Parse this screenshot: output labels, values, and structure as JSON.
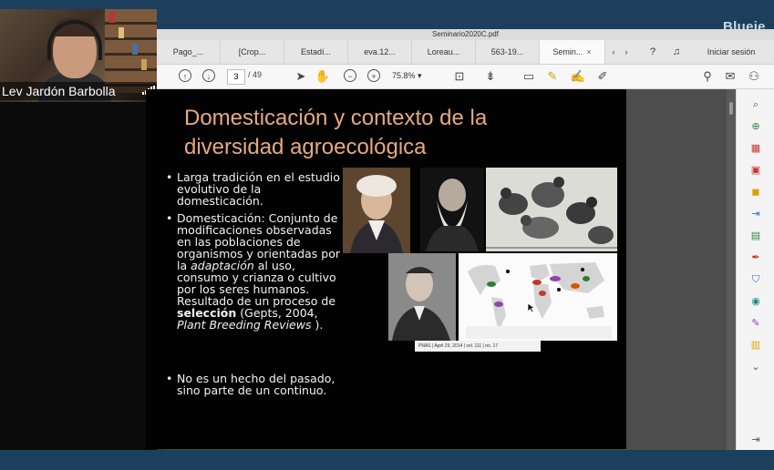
{
  "meeting": {
    "brand": "Blueje",
    "participant_name": "Lev Jardón Barbolla"
  },
  "acrobat": {
    "window_title": "Seminario2020C.pdf",
    "tabs": [
      "Pago_...",
      "[Crop...",
      "Estadí...",
      "eva.12...",
      "Loreau...",
      "563-19...",
      "Semin..."
    ],
    "active_tab_close": "×",
    "sign_in": "Iniciar sesión",
    "page": {
      "current": "3",
      "total": "/ 49"
    },
    "zoom": "75.8%"
  },
  "slide": {
    "title": "Domesticación y contexto de la diversidad agroecológica",
    "bullet1": "Larga tradición en el estudio evolutivo de la domesticación.",
    "bullet2_a": "Domesticación: Conjunto de modificaciones observadas en las poblaciones de organismos y orientadas por la ",
    "bullet2_italic": "adaptación",
    "bullet2_b": " al uso, consumo y crianza o cultivo por los seres humanos. Resultado de un proceso de ",
    "bullet2_bold": "selección",
    "bullet2_c": " (Gepts, 2004, ",
    "bullet2_italic2": "Plant Breeding Reviews",
    "bullet2_d": " ).",
    "bullet3": "No es un hecho del pasado, sino parte de un continuo.",
    "journal_footer": "PNAS | April 29, 2014 | vol. 111 | no. 17"
  },
  "colors": {
    "title": "#e6a982",
    "frame": "#1c3f5e"
  }
}
